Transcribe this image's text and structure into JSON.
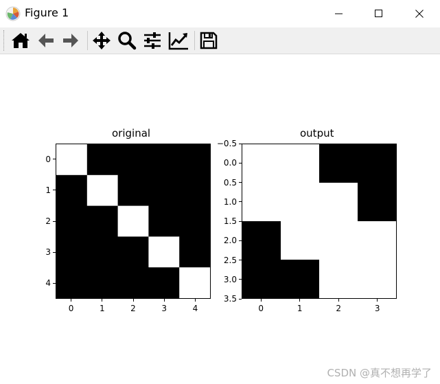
{
  "window": {
    "title": "Figure 1",
    "app_icon": "matplotlib-icon",
    "controls": [
      "minimize-icon",
      "maximize-icon",
      "close-icon"
    ]
  },
  "toolbar": {
    "buttons": [
      {
        "icon": "home-icon"
      },
      {
        "icon": "back-arrow-icon"
      },
      {
        "icon": "forward-arrow-icon"
      },
      {
        "icon": "pan-move-icon"
      },
      {
        "icon": "zoom-magnifier-icon"
      },
      {
        "icon": "configure-subplots-icon"
      },
      {
        "icon": "edit-axis-icon"
      },
      {
        "icon": "save-disk-icon"
      }
    ]
  },
  "chart_data": [
    {
      "type": "heatmap",
      "title": "original",
      "colormap": "gray",
      "rows": [
        [
          1,
          0,
          0,
          0,
          0
        ],
        [
          0,
          1,
          0,
          0,
          0
        ],
        [
          0,
          0,
          1,
          0,
          0
        ],
        [
          0,
          0,
          0,
          1,
          0
        ],
        [
          0,
          0,
          0,
          0,
          1
        ]
      ],
      "x_ticks": [
        "0",
        "1",
        "2",
        "3",
        "4"
      ],
      "y_ticks": [
        "0",
        "1",
        "2",
        "3",
        "4"
      ]
    },
    {
      "type": "heatmap",
      "title": "output",
      "colormap": "gray",
      "rows": [
        [
          1,
          1,
          0,
          0
        ],
        [
          1,
          1,
          1,
          0
        ],
        [
          0,
          1,
          1,
          1
        ],
        [
          0,
          0,
          1,
          1
        ]
      ],
      "x_ticks": [
        "0",
        "1",
        "2",
        "3"
      ],
      "y_ticks": [
        "−0.5",
        "0.0",
        "0.5",
        "1.0",
        "1.5",
        "2.0",
        "2.5",
        "3.0",
        "3.5"
      ]
    }
  ],
  "watermark": "CSDN @真不想再学了"
}
